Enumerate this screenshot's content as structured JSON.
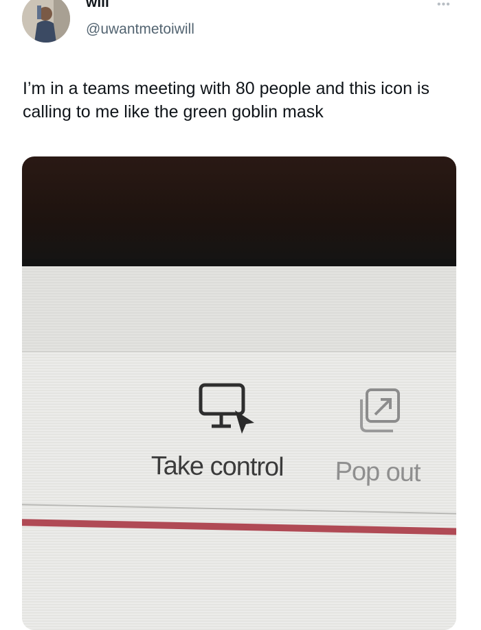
{
  "author": {
    "display_name": "will",
    "handle": "@uwantmetoiwill"
  },
  "tweet": {
    "text": "I’m in a teams meeting with 80 people and this icon is calling to me like the green goblin mask"
  },
  "photo": {
    "take_control_label": "Take control",
    "pop_out_label": "Pop out",
    "accent_red": "#b04a55"
  },
  "icons": {
    "take_control": "monitor-cursor-icon",
    "pop_out": "pop-out-icon",
    "more": "more-options-icon"
  }
}
